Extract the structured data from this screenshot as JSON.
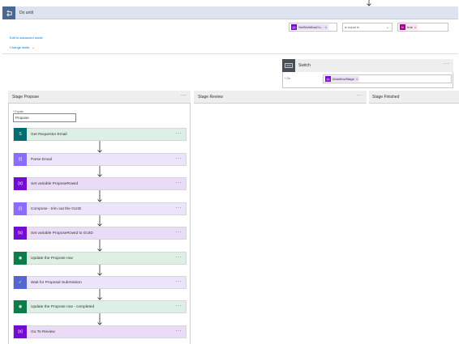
{
  "do_until": {
    "title": "Do until",
    "condition": {
      "left_token": "VarWorkflowCo...",
      "operator": "is equal to",
      "right_token": "true"
    },
    "edit_advanced": "Edit in advanced mode",
    "change_limits": "Change limits"
  },
  "switch": {
    "title": "Switch",
    "on_label": "* On",
    "on_token": "WorkflowStage"
  },
  "stages": [
    {
      "title": "Stage Propose"
    },
    {
      "title": "Stage Review"
    },
    {
      "title": "Stage Finished"
    }
  ],
  "propose": {
    "equals_label": "Equals",
    "equals_value": "Propose",
    "actions": [
      {
        "label": "Get Requestor Email",
        "icon": "sharepoint-icon"
      },
      {
        "label": "Parse Email",
        "icon": "compose-icon"
      },
      {
        "label": "Set variable ProposeRowId",
        "icon": "variable-icon"
      },
      {
        "label": "Compose - trim out the GUID",
        "icon": "compose-icon"
      },
      {
        "label": "Set variable ProposeRowId to GUID",
        "icon": "variable-icon"
      },
      {
        "label": "Update the Propose row",
        "icon": "dataverse-icon"
      },
      {
        "label": "Wait for Proposal Submission",
        "icon": "approval-icon"
      },
      {
        "label": "Update the Propose row - completed",
        "icon": "dataverse-icon"
      },
      {
        "label": "Go To Review",
        "icon": "variable-icon"
      }
    ]
  },
  "colors": {
    "accent_blue": "#0078d4",
    "do_until_icon": "#486991",
    "variable_purple": "#770bd6",
    "dataverse_green": "#0c7d4a"
  }
}
